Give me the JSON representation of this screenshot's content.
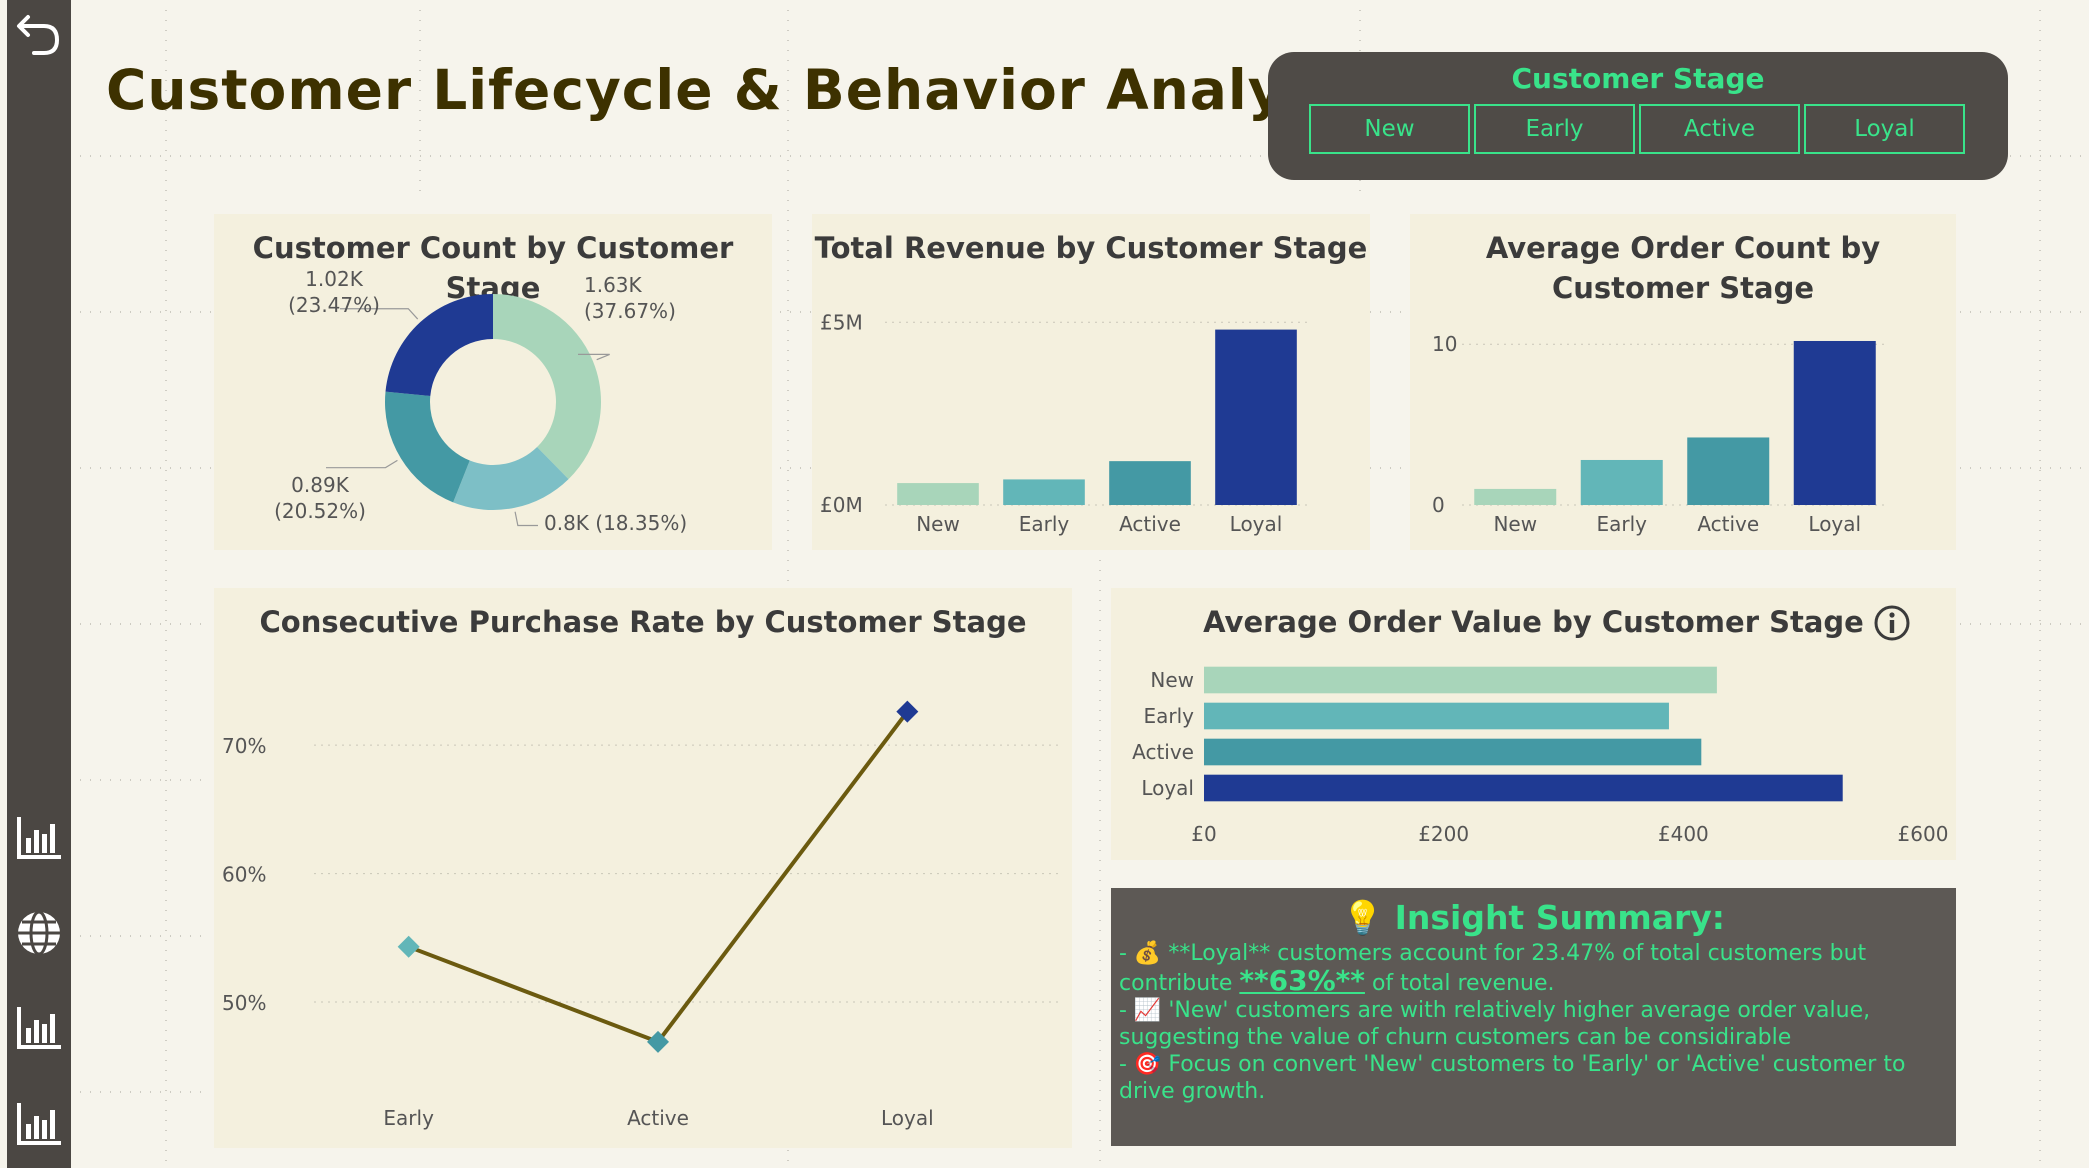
{
  "page_title": "Customer Lifecycle & Behavior Analysis",
  "slicer": {
    "title": "Customer Stage",
    "options": [
      "New",
      "Early",
      "Active",
      "Loyal"
    ]
  },
  "colors": {
    "new": "#a8d5ba",
    "early": "#62b6b8",
    "active": "#4499a4",
    "active_light": "#7dbfc6",
    "loyal": "#1f3a93",
    "line": "#6b5a0f",
    "accent_green": "#39e38a",
    "title_brown": "#3d3100"
  },
  "sidebar": {
    "icons": [
      "back-arrow-icon",
      "bar-chart-icon",
      "globe-icon",
      "bar-chart-icon",
      "bar-chart-icon"
    ]
  },
  "chart_data": [
    {
      "id": "donut",
      "type": "pie",
      "title": "Customer Count by Customer Stage",
      "slices": [
        {
          "label": "1.63K\n(37.67%)",
          "value": 37.67
        },
        {
          "label": "0.8K (18.35%)",
          "value": 18.35
        },
        {
          "label": "0.89K\n(20.52%)",
          "value": 20.52
        },
        {
          "label": "1.02K\n(23.47%)",
          "value": 23.47
        }
      ]
    },
    {
      "id": "revenue",
      "type": "bar",
      "title": "Total Revenue by Customer Stage",
      "categories": [
        "New",
        "Early",
        "Active",
        "Loyal"
      ],
      "values": [
        0.6,
        0.7,
        1.2,
        4.8
      ],
      "ylim": [
        0,
        5.5
      ],
      "yticks": [
        0,
        5
      ],
      "ytick_labels": [
        "£0M",
        "£5M"
      ]
    },
    {
      "id": "orders",
      "type": "bar",
      "title": "Average Order Count by Customer Stage",
      "categories": [
        "New",
        "Early",
        "Active",
        "Loyal"
      ],
      "values": [
        1.0,
        2.8,
        4.2,
        10.2
      ],
      "ylim": [
        0,
        12.5
      ],
      "yticks": [
        0,
        10
      ],
      "ytick_labels": [
        "0",
        "10"
      ]
    },
    {
      "id": "purchase_rate",
      "type": "line",
      "title": "Consecutive Purchase Rate by Customer Stage",
      "categories": [
        "Early",
        "Active",
        "Loyal"
      ],
      "values": [
        54.3,
        46.9,
        72.6
      ],
      "ylim": [
        43,
        76
      ],
      "yticks": [
        50,
        60,
        70
      ],
      "ytick_labels": [
        "50%",
        "60%",
        "70%"
      ]
    },
    {
      "id": "aov",
      "type": "bar",
      "title": "Average Order Value by Customer Stage",
      "orientation": "horizontal",
      "categories": [
        "New",
        "Early",
        "Active",
        "Loyal"
      ],
      "values": [
        428,
        388,
        415,
        533
      ],
      "xlim": [
        0,
        600
      ],
      "xticks": [
        0,
        200,
        400,
        600
      ],
      "xtick_labels": [
        "£0",
        "£200",
        "£400",
        "£600"
      ]
    }
  ],
  "insight": {
    "title": "💡 Insight Summary:",
    "line1_a": "- 💰 **Loyal** customers account for 23.47% of total customers but contribute ",
    "line1_emph": "**63%**",
    "line1_b": " of total revenue.",
    "line2": "- 📈 'New' customers are with relatively higher average order value, suggesting the value of churn customers can be considirable",
    "line3": "- 🎯 Focus on convert  'New' customers to 'Early' or 'Active' customer to drive growth."
  }
}
